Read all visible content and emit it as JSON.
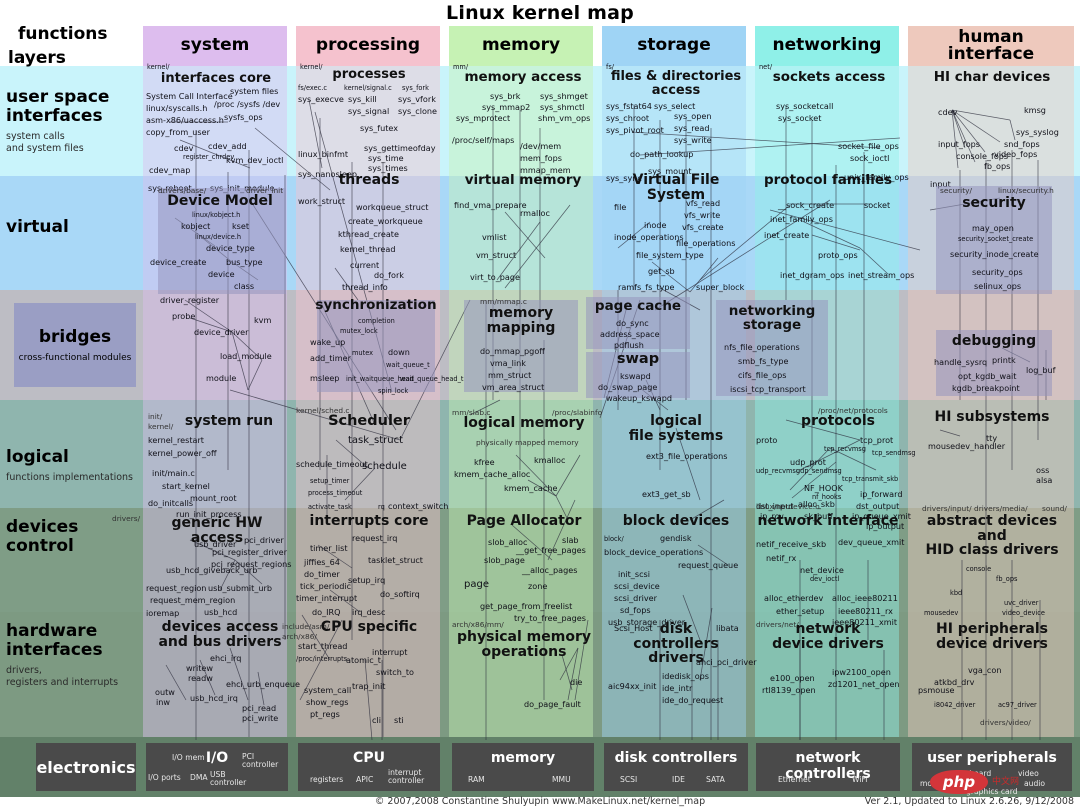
{
  "title": "Linux kernel map",
  "header": {
    "functions": "functions",
    "layers": "layers"
  },
  "footer": {
    "copyright": "© 2007,2008 Constantine Shulyupin www.MakeLinux.net/kernel_map",
    "version": "Ver 2.1, Updated to Linux 2.6.26, 9/12/2008",
    "watermark": "php",
    "watermark2": "中文网"
  },
  "layers": [
    {
      "name": "user space\ninterfaces",
      "sub": "system calls\nand system files",
      "color": "#c9f4fb"
    },
    {
      "name": "virtual",
      "sub": "",
      "color": "#a9d8f7"
    },
    {
      "name": "bridges",
      "sub": "cross-functional modules",
      "color": "#bdbdc4"
    },
    {
      "name": "logical",
      "sub": "functions implementations",
      "color": "#8fb5ae"
    },
    {
      "name": "devices\ncontrol",
      "sub": "",
      "color": "#7f9d86"
    },
    {
      "name": "hardware\ninterfaces",
      "sub": "drivers,\nregisters and interrupts",
      "color": "#7d9a82"
    },
    {
      "name": "electronics",
      "sub": "",
      "color": "#628169"
    }
  ],
  "columns": [
    {
      "name": "system",
      "path": "kernel/",
      "color": "#ddbdee"
    },
    {
      "name": "processing",
      "path": "kernel/",
      "color": "#f5c2ce"
    },
    {
      "name": "memory",
      "path": "mm/",
      "color": "#c6f2b4"
    },
    {
      "name": "storage",
      "path": "fs/",
      "color": "#9fd4f5"
    },
    {
      "name": "networking",
      "path": "net/",
      "color": "#8ff0e8"
    },
    {
      "name": "human\ninterface",
      "path": "",
      "color": "#eec9bd"
    }
  ],
  "groups": [
    {
      "id": "interfaces-core",
      "title": "interfaces core",
      "items": [
        "System Call Interface",
        "system files",
        "linux/syscalls.h",
        "/proc  /sysfs  /dev",
        "asm-x86/uaccess.h",
        "sysfs_ops",
        "copy_from_user",
        "cdev",
        "cdev_add",
        "register_chrdev",
        "kvm_dev_ioctl",
        "cdev_map",
        "sys_reboot",
        "sys_init_module"
      ]
    },
    {
      "id": "processes",
      "title": "processes",
      "items": [
        "fs/exec.c",
        "kernel/signal.c",
        "sys_fork",
        "sys_execve",
        "sys_kill",
        "sys_vfork",
        "sys_signal",
        "sys_clone",
        "sys_futex",
        "sys_gettimeofday",
        "sys_time",
        "sys_times",
        "linux_binfmt",
        "sys_nanosleep"
      ]
    },
    {
      "id": "memory-access",
      "title": "memory access",
      "items": [
        "sys_brk",
        "sys_shmget",
        "sys_mmap2",
        "sys_shmctl",
        "sys_mprotect",
        "shm_vm_ops",
        "/proc/self/maps",
        "/dev/mem",
        "mem_fops",
        "mmap_mem"
      ]
    },
    {
      "id": "files-directories",
      "title": "files & directories\naccess",
      "items": [
        "sys_fstat64",
        "sys_select",
        "sys_chroot",
        "sys_open",
        "sys_pivot_root",
        "sys_read",
        "sys_write",
        "do_path_lookup",
        "sys_mount",
        "sys_sync"
      ]
    },
    {
      "id": "sockets-access",
      "title": "sockets access",
      "items": [
        "sys_socketcall",
        "sys_socket",
        "socket_file_ops",
        "sock_ioctl"
      ]
    },
    {
      "id": "hi-char-devices",
      "title": "HI char devices",
      "items": [
        "cdev",
        "kmsg",
        "sys_syslog",
        "input_fops",
        "snd_fops",
        "console_fops",
        "video_fops",
        "fb_ops",
        "input"
      ]
    },
    {
      "id": "device-model",
      "title": "Device Model",
      "sub": [
        "drivers/base/",
        "driver_init"
      ],
      "items": [
        "linux/kobject.h",
        "kobject",
        "kset",
        "linux/device.h",
        "device_type",
        "device_create",
        "bus_type",
        "device",
        "class",
        "driver_register",
        "probe",
        "device_driver",
        "kvm",
        "load_module",
        "module"
      ]
    },
    {
      "id": "threads",
      "title": "threads",
      "items": [
        "work_struct",
        "workqueue_struct",
        "create_workqueue",
        "kthread_create",
        "kernel_thread",
        "current",
        "do_fork",
        "thread_info"
      ]
    },
    {
      "id": "virtual-memory",
      "title": "virtual memory",
      "items": [
        "find_vma_prepare",
        "rmalloc",
        "vmlist",
        "vm_struct",
        "virt_to_page"
      ]
    },
    {
      "id": "vfs",
      "title": "Virtual File System",
      "items": [
        "file",
        "vfs_read",
        "inode",
        "vfs_write",
        "inode_operations",
        "vfs_create",
        "file_operations",
        "file_system_type",
        "get_sb",
        "ramfs_fs_type",
        "super_block"
      ]
    },
    {
      "id": "protocol-families",
      "title": "protocol families",
      "items": [
        "__sock_create",
        "socket",
        "inet_family_ops",
        "inet_create",
        "unix_family_ops",
        "proto_ops",
        "inet_dgram_ops",
        "inet_stream_ops"
      ]
    },
    {
      "id": "security",
      "title": "security",
      "sub": [
        "security/",
        "linux/security.h"
      ],
      "items": [
        "may_open",
        "security_socket_create",
        "security_inode_create",
        "security_ops",
        "selinux_ops"
      ]
    },
    {
      "id": "synchronization",
      "title": "synchronization",
      "items": [
        "completion",
        "mutex_lock",
        "wake_up",
        "mutex",
        "down",
        "add_timer",
        "wait_queue_t",
        "msleep",
        "init_waitqueue_head",
        "wait_queue_head_t",
        "spin_lock"
      ]
    },
    {
      "id": "memory-mapping",
      "title": "memory\nmapping",
      "sub": [
        "mm/mmap.c"
      ],
      "items": [
        "do_mmap_pgoff",
        "vma_link",
        "mm_struct",
        "vm_area_struct"
      ]
    },
    {
      "id": "page-cache",
      "title": "page cache",
      "items": [
        "do_sync",
        "address_space",
        "pdflush"
      ]
    },
    {
      "id": "swap",
      "title": "swap",
      "items": [
        "kswapd",
        "do_swap_page",
        "wakeup_kswapd"
      ]
    },
    {
      "id": "networking-storage",
      "title": "networking\nstorage",
      "items": [
        "nfs_file_operations",
        "smb_fs_type",
        "cifs_file_ops",
        "iscsi_tcp_transport"
      ]
    },
    {
      "id": "debugging",
      "title": "debugging",
      "items": [
        "handle_sysrq",
        "printk",
        "log_buf",
        "opt_kgdb_wait",
        "kgdb_breakpoint"
      ]
    },
    {
      "id": "system-run",
      "title": "system run",
      "sub": [
        "init/",
        "kernel/"
      ],
      "items": [
        "kernel_restart",
        "kernel_power_off",
        "init/main.c",
        "start_kernel",
        "do_initcalls",
        "mount_root",
        "run_init_process"
      ]
    },
    {
      "id": "scheduler",
      "title": "Scheduler",
      "sub": [
        "kernel/sched.c"
      ],
      "items": [
        "task_struct",
        "schedule_timeout",
        "schedule",
        "setup_timer",
        "process_timeout",
        "activate_task",
        "rq",
        "context_switch"
      ]
    },
    {
      "id": "logical-memory",
      "title": "logical memory",
      "sub": [
        "mm/slab.c",
        "/proc/slabinfo",
        "physically mapped memory"
      ],
      "items": [
        "kfree",
        "kmalloc",
        "kmem_cache_alloc",
        "kmem_cache"
      ]
    },
    {
      "id": "logical-fs",
      "title": "logical\nfile systems",
      "items": [
        "ext3_file_operations",
        "ext3_get_sb"
      ]
    },
    {
      "id": "protocols",
      "title": "protocols",
      "sub": [
        "/proc/net/protocols"
      ],
      "items": [
        "proto",
        "tcp_prot",
        "tcp_recvmsg",
        "tcp_sendmsg",
        "udp_prot",
        "udp_recvmsg",
        "udp_sendmsg",
        "tcp_transmit_skb",
        "NF_HOOK",
        "nf_hooks",
        "ip_forward",
        "dst_input",
        "alloc_skb",
        "dst_output",
        "ip_rcv",
        "sk_buff",
        "ip_queue_xmit",
        "ip_output"
      ]
    },
    {
      "id": "hi-subsystems",
      "title": "HI subsystems",
      "items": [
        "tty",
        "mousedev_handler",
        "oss",
        "alsa"
      ]
    },
    {
      "id": "generic-hw-access",
      "title": "generic HW access",
      "sub": [
        "drivers/"
      ],
      "items": [
        "usb_driver",
        "pci_driver",
        "pci_register_driver",
        "pci_request_regions",
        "usb_hcd_giveback_urb",
        "request_region",
        "usb_submit_urb",
        "request_mem_region",
        "usb_hcd",
        "ioremap"
      ]
    },
    {
      "id": "interrupts-core",
      "title": "interrupts core",
      "items": [
        "request_irq",
        "timer_list",
        "tasklet_struct",
        "jiffies_64",
        "do_timer",
        "tick_periodic",
        "setup_irq",
        "timer_interrupt",
        "do_softirq",
        "do_IRQ",
        "irq_desc"
      ]
    },
    {
      "id": "page-allocator",
      "title": "Page Allocator",
      "items": [
        "slob_alloc",
        "slab",
        "__get_free_pages",
        "slob_page",
        "__alloc_pages",
        "page",
        "zone",
        "get_page_from_freelist",
        "try_to_free_pages"
      ]
    },
    {
      "id": "block-devices",
      "title": "block devices",
      "sub": [
        "block/"
      ],
      "items": [
        "gendisk",
        "block_device_operations",
        "request_queue",
        "init_scsi",
        "scsi_device",
        "scsi_driver",
        "sd_fops",
        "usb_storage_driver"
      ]
    },
    {
      "id": "network-interface",
      "title": "network interface",
      "sub": [
        "linux/netdevice.h",
        "drivers/net/"
      ],
      "items": [
        "netif_receive_skb",
        "dev_queue_xmit",
        "netif_rx",
        "net_device",
        "dev_ioctl",
        "alloc_etherdev",
        "alloc_ieee80211",
        "ether_setup",
        "ieee80211_rx",
        "ieee80211_xmit"
      ]
    },
    {
      "id": "abstract-devices",
      "title": "abstract devices\nand\nHID class drivers",
      "sub": [
        "drivers/input/",
        "drivers/media/",
        "sound/"
      ],
      "items": [
        "console",
        "fb_ops",
        "kbd",
        "uvc_driver",
        "mousedev",
        "video_device"
      ]
    },
    {
      "id": "devices-access",
      "title": "devices access\nand bus drivers",
      "items": [
        "ehci_irq",
        "writew",
        "readw",
        "ehci_urb_enqueue",
        "outw",
        "usb_hcd_irq",
        "inw",
        "pci_read",
        "pci_write"
      ]
    },
    {
      "id": "cpu-specific",
      "title": "CPU specific",
      "sub": [
        "include/asm/",
        "arch/x86/"
      ],
      "items": [
        "start_thread",
        "interrupt",
        "/proc/interrupts",
        "atomic_t",
        "switch_to",
        "trap_init",
        "system_call",
        "show_regs",
        "pt_regs",
        "cli",
        "sti"
      ]
    },
    {
      "id": "physical-memory",
      "title": "physical memory\noperations",
      "sub": [
        "arch/x86/mm/"
      ],
      "items": [
        "die",
        "do_page_fault"
      ]
    },
    {
      "id": "disk-controllers-drivers",
      "title": "disk\ncontrollers drivers",
      "items": [
        "Scsi_Host",
        "libata",
        "ahci_pci_driver",
        "idedisk_ops",
        "aic94xx_init",
        "ide_intr",
        "ide_do_request"
      ]
    },
    {
      "id": "network-device-drivers",
      "title": "network\ndevice drivers",
      "items": [
        "e100_open",
        "ipw2100_open",
        "zd1201_net_open",
        "rtl8139_open"
      ]
    },
    {
      "id": "hi-peripherals",
      "title": "HI peripherals\ndevice drivers",
      "sub": [
        "drivers/video/"
      ],
      "items": [
        "vga_con",
        "atkbd_drv",
        "psmouse",
        "i8042_driver",
        "ac97_driver"
      ]
    }
  ],
  "electronics": [
    {
      "name": "I/O",
      "items": [
        "I/O mem",
        "PCI\ncontroller",
        "I/O ports",
        "DMA",
        "USB\ncontroller"
      ]
    },
    {
      "name": "CPU",
      "items": [
        "registers",
        "APIC",
        "interrupt\ncontroller"
      ]
    },
    {
      "name": "memory",
      "items": [
        "RAM",
        "MMU"
      ]
    },
    {
      "name": "disk controllers",
      "items": [
        "SCSI",
        "IDE",
        "SATA"
      ]
    },
    {
      "name": "network controllers",
      "items": [
        "Ethernet",
        "WiFi"
      ]
    },
    {
      "name": "user peripherals",
      "items": [
        "keyboard",
        "video",
        "mouse",
        "audio",
        "graphics card"
      ]
    }
  ]
}
